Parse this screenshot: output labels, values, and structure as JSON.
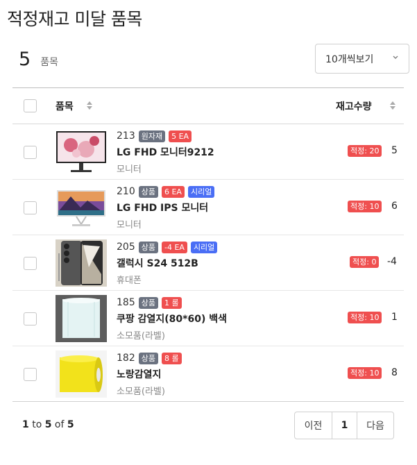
{
  "page": {
    "title": "적정재고 미달 품목",
    "count": "5",
    "count_unit": "품목",
    "per_page": "10개씩보기"
  },
  "table": {
    "headers": {
      "item": "품목",
      "stock": "재고수량"
    },
    "rows": [
      {
        "code": "213",
        "type": "원자재",
        "unit_badge": "5 EA",
        "serial": "",
        "name": "LG FHD 모니터9212",
        "category": "모니터",
        "optimal": "적정: 20",
        "qty": "5"
      },
      {
        "code": "210",
        "type": "상품",
        "unit_badge": "6 EA",
        "serial": "시리얼",
        "name": "LG FHD IPS 모니터",
        "category": "모니터",
        "optimal": "적정: 10",
        "qty": "6"
      },
      {
        "code": "205",
        "type": "상품",
        "unit_badge": "-4 EA",
        "serial": "시리얼",
        "name": "갤럭시 S24 512B",
        "category": "휴대폰",
        "optimal": "적정: 0",
        "qty": "-4"
      },
      {
        "code": "185",
        "type": "상품",
        "unit_badge": "1 롤",
        "serial": "",
        "name": "쿠팡 감열지(80*60) 백색",
        "category": "소모품(라벨)",
        "optimal": "적정: 10",
        "qty": "1"
      },
      {
        "code": "182",
        "type": "상품",
        "unit_badge": "8 롤",
        "serial": "",
        "name": "노랑감열지",
        "category": "소모품(라벨)",
        "optimal": "적정: 10",
        "qty": "8"
      }
    ]
  },
  "footer": {
    "range_start": "1",
    "range_to": "to",
    "range_end": "5",
    "range_of": "of",
    "total": "5",
    "prev": "이전",
    "page": "1",
    "next": "다음"
  }
}
